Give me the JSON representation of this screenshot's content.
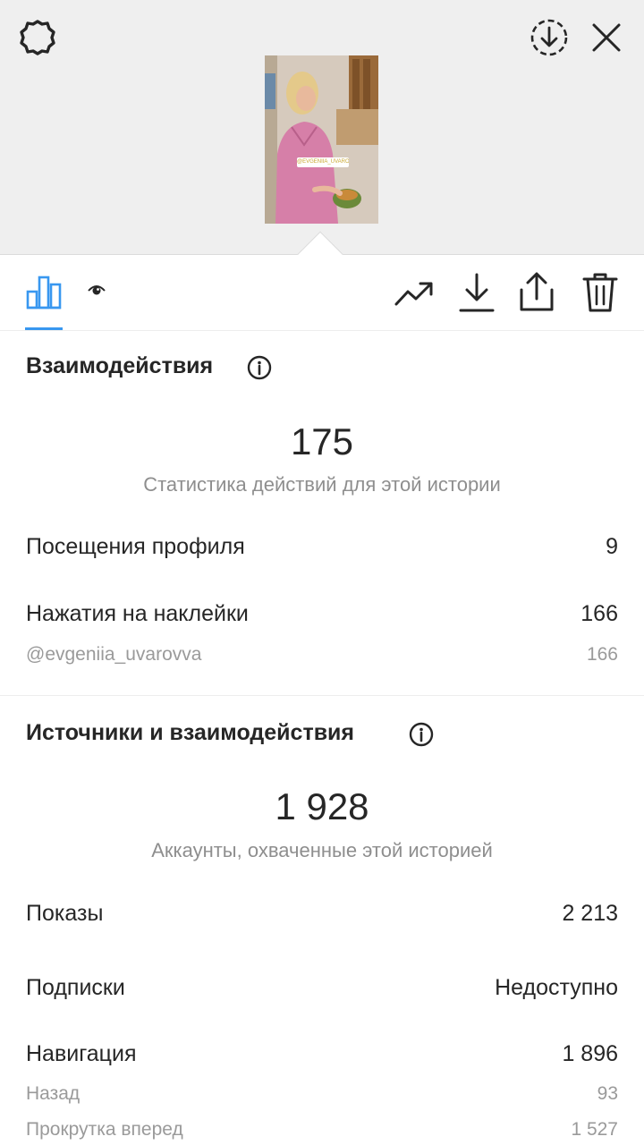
{
  "colors": {
    "accent": "#3897f0",
    "text_primary": "#262626",
    "text_secondary": "#8e8e8e",
    "background_top": "#efefef"
  },
  "header": {
    "icons": [
      "settings-icon",
      "save-story-icon",
      "close-icon"
    ],
    "story_sticker": "@EVGENIIA_UVAROVVA"
  },
  "toolbar": {
    "icons": [
      "insights-icon",
      "viewers-icon",
      "promote-icon",
      "download-icon",
      "share-icon",
      "trash-icon"
    ]
  },
  "interactions": {
    "title": "Взаимодействия",
    "total": "175",
    "caption": "Статистика действий для этой истории",
    "rows": [
      {
        "label": "Посещения профиля",
        "value": "9"
      },
      {
        "label": "Нажатия на наклейки",
        "value": "166"
      }
    ],
    "sub_rows": [
      {
        "label": "@evgeniia_uvarovva",
        "value": "166"
      }
    ]
  },
  "discovery": {
    "title": "Источники и взаимодействия",
    "total": "1 928",
    "caption": "Аккаунты, охваченные этой историей",
    "rows": [
      {
        "label": "Показы",
        "value": "2 213"
      },
      {
        "label": "Подписки",
        "value": "Недоступно"
      },
      {
        "label": "Навигация",
        "value": "1 896"
      }
    ],
    "sub_rows": [
      {
        "label": "Назад",
        "value": "93"
      },
      {
        "label": "Прокрутка вперед",
        "value": "1 527"
      }
    ]
  }
}
